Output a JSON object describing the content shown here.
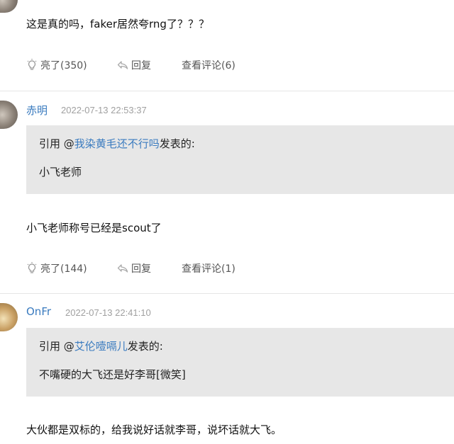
{
  "comments": [
    {
      "text": "这是真的吗，faker居然夸rng了？？？",
      "actions": {
        "like": "亮了(350)",
        "reply": "回复",
        "view": "查看评论(6)"
      }
    },
    {
      "author": "赤明",
      "time": "2022-07-13 22:53:37",
      "quote": {
        "prefix": "引用 @",
        "user": "我染黄毛还不行吗",
        "suffix": "发表的:",
        "text": "小飞老师"
      },
      "text": "小飞老师称号已经是scout了",
      "actions": {
        "like": "亮了(144)",
        "reply": "回复",
        "view": "查看评论(1)"
      }
    },
    {
      "author": "OnFr",
      "time": "2022-07-13 22:41:10",
      "quote": {
        "prefix": "引用 @",
        "user": "艾伦噎嗝儿",
        "suffix": "发表的:",
        "text": "不嘴硬的大飞还是好李哥[微笑]"
      },
      "text": "大伙都是双标的，给我说好话就李哥，说坏话就大飞。"
    }
  ],
  "colors": {
    "link": "#3a7bbf",
    "quote_bg": "#e7e7e7",
    "meta": "#a0a0a0"
  },
  "icons": {
    "like": "lightbulb-icon",
    "reply": "reply-arrow-icon"
  }
}
